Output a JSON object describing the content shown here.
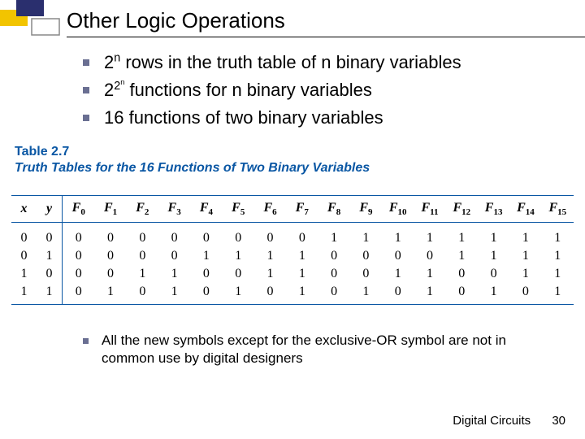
{
  "title": "Other Logic Operations",
  "bullets": {
    "b1_pre": "2",
    "b1_sup": "n",
    "b1_post": " rows in the truth table of n binary variables",
    "b2_pre": "2",
    "b2_mid": "2",
    "b2_sup": "n",
    "b2_post": " functions for n binary variables",
    "b3": "16 functions of two binary variables"
  },
  "table": {
    "label_num": "Table 2.7",
    "label_title": "Truth Tables for the 16 Functions of Two Binary Variables",
    "head_x": "x",
    "head_y": "y",
    "fn_prefix": "F",
    "fn_indices": [
      "0",
      "1",
      "2",
      "3",
      "4",
      "5",
      "6",
      "7",
      "8",
      "9",
      "10",
      "11",
      "12",
      "13",
      "14",
      "15"
    ]
  },
  "chart_data": {
    "type": "table",
    "title": "Truth Tables for the 16 Functions of Two Binary Variables",
    "columns": [
      "x",
      "y",
      "F0",
      "F1",
      "F2",
      "F3",
      "F4",
      "F5",
      "F6",
      "F7",
      "F8",
      "F9",
      "F10",
      "F11",
      "F12",
      "F13",
      "F14",
      "F15"
    ],
    "rows": [
      [
        0,
        0,
        0,
        0,
        0,
        0,
        0,
        0,
        0,
        0,
        1,
        1,
        1,
        1,
        1,
        1,
        1,
        1
      ],
      [
        0,
        1,
        0,
        0,
        0,
        0,
        1,
        1,
        1,
        1,
        0,
        0,
        0,
        0,
        1,
        1,
        1,
        1
      ],
      [
        1,
        0,
        0,
        0,
        1,
        1,
        0,
        0,
        1,
        1,
        0,
        0,
        1,
        1,
        0,
        0,
        1,
        1
      ],
      [
        1,
        1,
        0,
        1,
        0,
        1,
        0,
        1,
        0,
        1,
        0,
        1,
        0,
        1,
        0,
        1,
        0,
        1
      ]
    ]
  },
  "note": "All the new symbols except for the exclusive-OR symbol are not in common use by digital designers",
  "footer": {
    "course": "Digital Circuits",
    "page": "30"
  },
  "colors": {
    "accent_blue": "#0a57a4",
    "deco_yellow": "#f2c400",
    "deco_navy": "#2a2f6e",
    "bullet": "#6a6f92"
  }
}
